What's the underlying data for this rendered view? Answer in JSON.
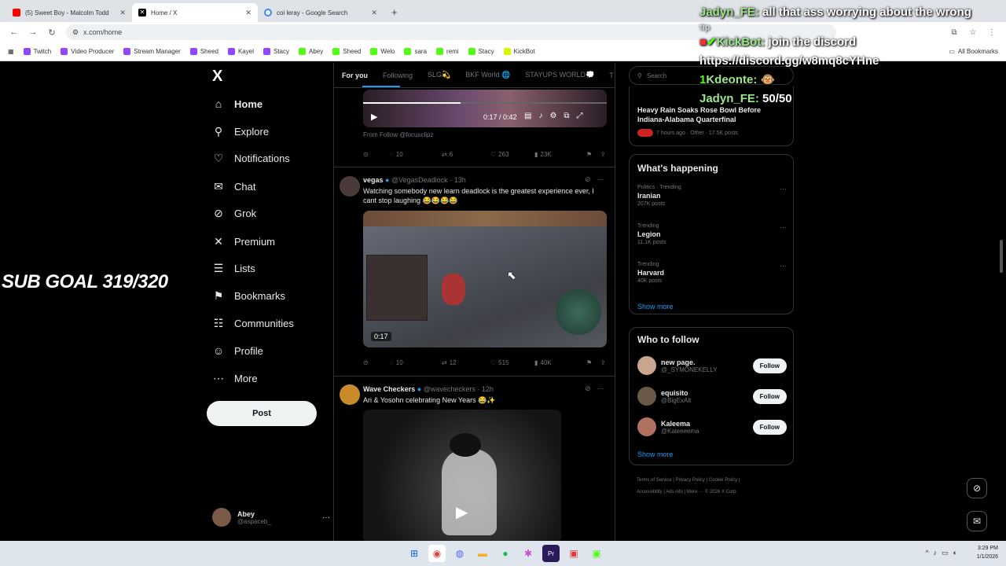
{
  "browser": {
    "tabs": [
      {
        "label": "(5) Sweet Boy - Malcolm Todd",
        "color": "#ff0000"
      },
      {
        "label": "Home / X",
        "color": "#000000"
      },
      {
        "label": "coi leray - Google Search",
        "color": "#4285f4"
      }
    ],
    "new_tab": "+",
    "url": "x.com/home",
    "bookmarks": [
      {
        "label": "Twitch",
        "color": "#9146ff"
      },
      {
        "label": "Video Producer",
        "color": "#9146ff"
      },
      {
        "label": "Stream Manager",
        "color": "#9146ff"
      },
      {
        "label": "Sheed",
        "color": "#9146ff"
      },
      {
        "label": "Kayel",
        "color": "#9146ff"
      },
      {
        "label": "Stacy",
        "color": "#9146ff"
      },
      {
        "label": "Abey",
        "color": "#53fc18"
      },
      {
        "label": "Sheed",
        "color": "#53fc18"
      },
      {
        "label": "Welo",
        "color": "#53fc18"
      },
      {
        "label": "sara",
        "color": "#53fc18"
      },
      {
        "label": "remi",
        "color": "#53fc18"
      },
      {
        "label": "Stacy",
        "color": "#53fc18"
      },
      {
        "label": "KickBot",
        "color": "#d7f500"
      }
    ],
    "all_bookmarks": "All Bookmarks"
  },
  "sidebar": {
    "logo": "X",
    "items": [
      {
        "label": "Home",
        "icon": "home-icon",
        "glyph": "⌂"
      },
      {
        "label": "Explore",
        "icon": "search-icon",
        "glyph": "⚲"
      },
      {
        "label": "Notifications",
        "icon": "bell-icon",
        "glyph": "♫"
      },
      {
        "label": "Chat",
        "icon": "mail-icon",
        "glyph": "✉"
      },
      {
        "label": "Grok",
        "icon": "grok-icon",
        "glyph": "⊘"
      },
      {
        "label": "Premium",
        "icon": "x-icon",
        "glyph": "✕"
      },
      {
        "label": "Lists",
        "icon": "list-icon",
        "glyph": "☰"
      },
      {
        "label": "Bookmarks",
        "icon": "bookmark-icon",
        "glyph": "⚑"
      },
      {
        "label": "Communities",
        "icon": "people-icon",
        "glyph": "☷"
      },
      {
        "label": "Profile",
        "icon": "person-icon",
        "glyph": "☺"
      },
      {
        "label": "More",
        "icon": "more-icon",
        "glyph": "⋯"
      }
    ],
    "post_label": "Post",
    "account": {
      "name": "Abey",
      "handle": "@aspaceb_",
      "more": "···"
    }
  },
  "feed": {
    "tabs": [
      "For you",
      "Following",
      "SLG💫",
      "BKF World 🌐",
      "STAYUPS WORLD💭",
      "T"
    ],
    "tweet1": {
      "video_time": "0:17 / 0:42",
      "from": "From Follow @focusclipz",
      "replies": "10",
      "reposts": "6",
      "likes": "263",
      "views": "23K"
    },
    "tweet2": {
      "name": "vegas",
      "handle": "@VegasDeadlock",
      "time": "· 13h",
      "text": "Watching somebody new learn deadlock is the greatest experience ever, I cant stop laughing 😂😂😂😂",
      "video_time": "0:17",
      "replies": "10",
      "reposts": "12",
      "likes": "515",
      "views": "40K"
    },
    "tweet3": {
      "name": "Wave Checkers",
      "handle": "@wavecheckers",
      "time": "· 12h",
      "text": "Ari & Yosohn celebrating New Years 😂✨"
    }
  },
  "right": {
    "search_placeholder": "Search",
    "news": {
      "title": "Heavy Rain Soaks Rose Bowl Before Indiana-Alabama Quarterfinal",
      "meta": "7 hours ago · Other · 17.5K posts"
    },
    "happening_title": "What's happening",
    "trends": [
      {
        "context": "Politics · Trending",
        "name": "Iranian",
        "posts": "207K posts"
      },
      {
        "context": "Trending",
        "name": "Legion",
        "posts": "11.1K posts"
      },
      {
        "context": "Trending",
        "name": "Harvard",
        "posts": "40K posts"
      }
    ],
    "show_more": "Show more",
    "follow_title": "Who to follow",
    "follows": [
      {
        "name": "new page.",
        "handle": "@_SYMONEKELLY",
        "button": "Follow",
        "color": "#c9a58e"
      },
      {
        "name": "equisito",
        "handle": "@BigExAlt",
        "button": "Follow",
        "color": "#6b5a4a"
      },
      {
        "name": "Kaleema",
        "handle": "@Kaleeeema",
        "button": "Follow",
        "color": "#b07060"
      }
    ],
    "footer": [
      "Terms of Service",
      "Privacy Policy",
      "Cookie Policy",
      "Accessibility",
      "Ads info",
      "More ···",
      "© 2026 X Corp."
    ]
  },
  "overlay": {
    "sub_goal": "SUB GOAL 319/320",
    "chat": [
      {
        "user": "Jadyn_FE:",
        "msg": "all that ass worrying about the wrong"
      },
      {
        "user": "KickBot:",
        "msg": "join the discord https://discord.gg/w8mq8cYHne"
      },
      {
        "user": "Kdeonte:",
        "msg": "🐵"
      },
      {
        "user": "Jadyn_FE:",
        "msg": "50/50"
      }
    ]
  },
  "taskbar": {
    "time": "3:29 PM",
    "date": "1/1/2026"
  }
}
